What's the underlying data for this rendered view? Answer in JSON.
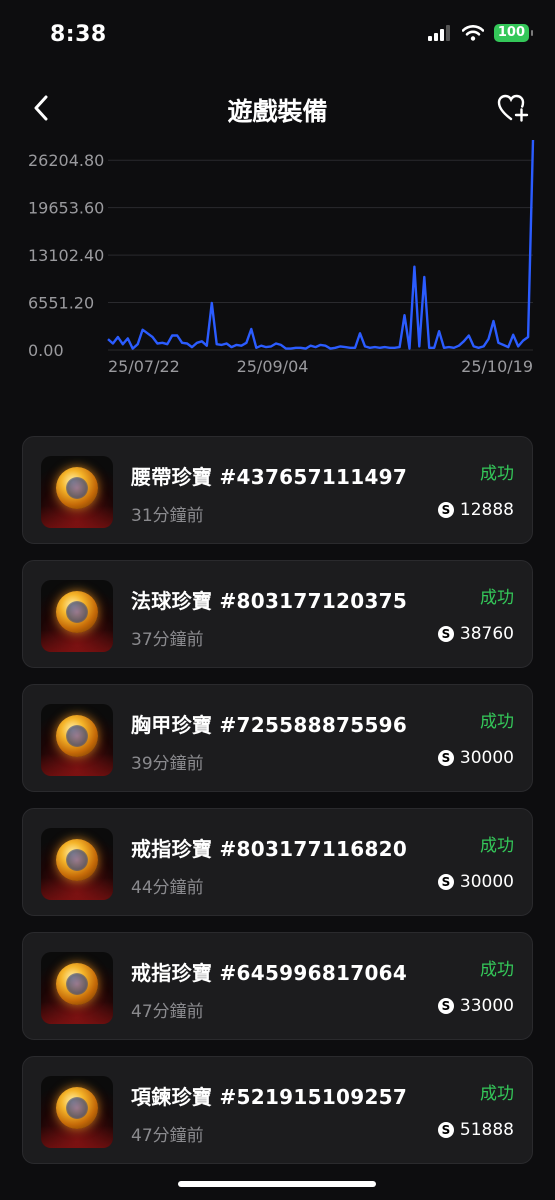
{
  "status_bar": {
    "time": "8:38",
    "battery": "100"
  },
  "header": {
    "title": "遊戲裝備",
    "back_icon": "chevron-left-icon",
    "favorite_icon": "heart-plus-icon"
  },
  "chart_data": {
    "type": "line",
    "y_ticks": [
      "26204.80",
      "19653.60",
      "13102.40",
      "6551.20",
      "0.00"
    ],
    "ylim": [
      0,
      29000
    ],
    "x_ticks": [
      "25/07/22",
      "25/09/04",
      "25/10/19"
    ],
    "grid": true,
    "color": "#2b5cff",
    "values": [
      1500,
      900,
      1800,
      800,
      1600,
      200,
      800,
      2800,
      2300,
      1800,
      900,
      1000,
      800,
      2000,
      2000,
      1000,
      900,
      400,
      1000,
      1200,
      600,
      6500,
      800,
      700,
      900,
      400,
      700,
      600,
      1000,
      2900,
      300,
      600,
      400,
      500,
      900,
      700,
      200,
      200,
      300,
      300,
      200,
      600,
      400,
      700,
      600,
      200,
      300,
      500,
      400,
      300,
      300,
      2300,
      500,
      300,
      400,
      300,
      400,
      300,
      300,
      400,
      4800,
      200,
      11500,
      500,
      10100,
      300,
      300,
      2600,
      300,
      400,
      300,
      600,
      1200,
      2000,
      500,
      300,
      500,
      1500,
      4000,
      1000,
      700,
      400,
      2100,
      500,
      1300,
      1800,
      29000
    ]
  },
  "items": [
    {
      "name": "腰帶珍寶 #437657111497",
      "time": "31分鐘前",
      "status": "成功",
      "currency": "S",
      "price": "12888"
    },
    {
      "name": "法球珍寶 #803177120375",
      "time": "37分鐘前",
      "status": "成功",
      "currency": "S",
      "price": "38760"
    },
    {
      "name": "胸甲珍寶 #725588875596",
      "time": "39分鐘前",
      "status": "成功",
      "currency": "S",
      "price": "30000"
    },
    {
      "name": "戒指珍寶 #803177116820",
      "time": "44分鐘前",
      "status": "成功",
      "currency": "S",
      "price": "30000"
    },
    {
      "name": "戒指珍寶 #645996817064",
      "time": "47分鐘前",
      "status": "成功",
      "currency": "S",
      "price": "33000"
    },
    {
      "name": "項鍊珍寶 #521915109257",
      "time": "47分鐘前",
      "status": "成功",
      "currency": "S",
      "price": "51888"
    }
  ]
}
